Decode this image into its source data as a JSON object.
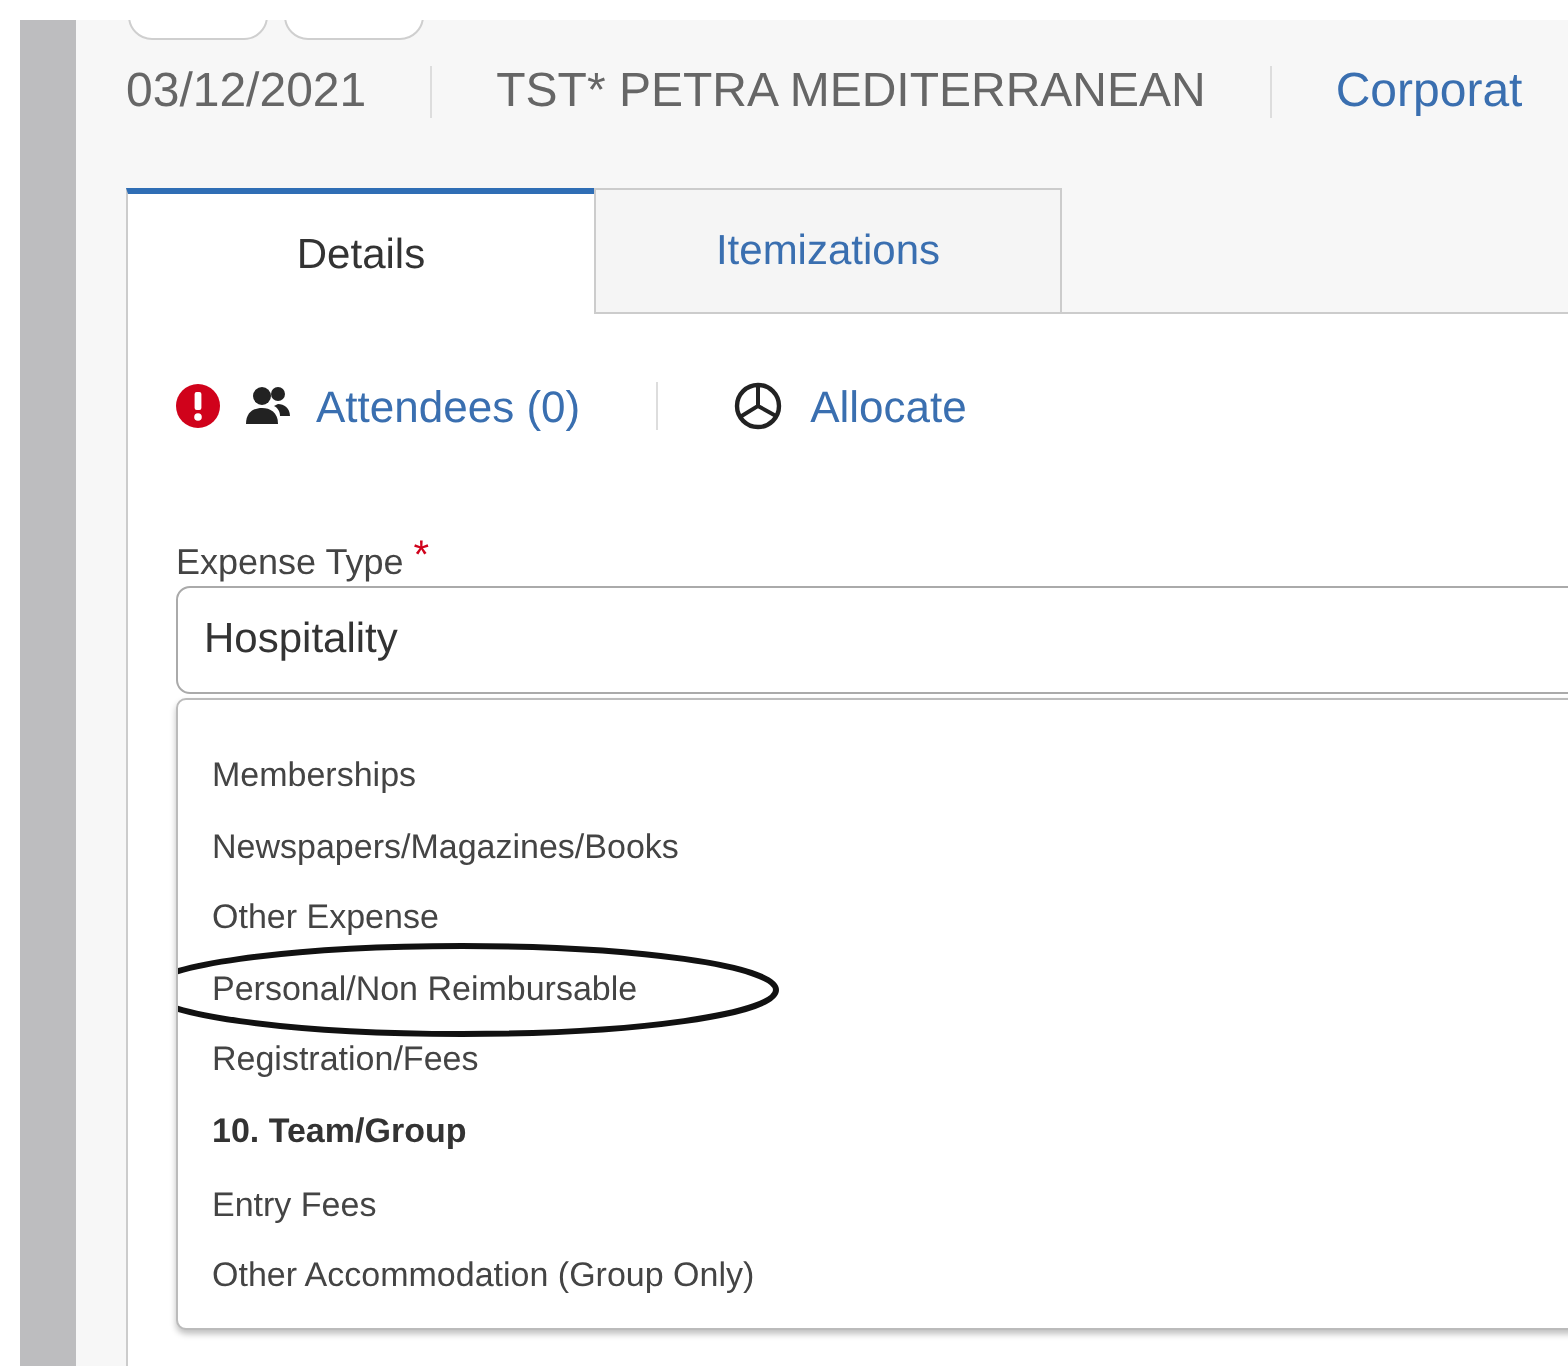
{
  "header": {
    "date": "03/12/2021",
    "merchant": "TST* PETRA MEDITERRANEAN",
    "link": "Corporat"
  },
  "tabs": [
    {
      "label": "Details",
      "selected": true
    },
    {
      "label": "Itemizations",
      "selected": false
    }
  ],
  "actions": {
    "attendees": "Attendees (0)",
    "attendees_warning": true,
    "allocate": "Allocate"
  },
  "expense_type": {
    "label": "Expense Type",
    "required": true,
    "required_mark": "*",
    "value": "Hospitality",
    "options": [
      {
        "kind": "option",
        "label": "Memberships",
        "circled": false
      },
      {
        "kind": "option",
        "label": "Newspapers/Magazines/Books",
        "circled": false
      },
      {
        "kind": "option",
        "label": "Other Expense",
        "circled": false
      },
      {
        "kind": "option",
        "label": "Personal/Non Reimbursable",
        "circled": true
      },
      {
        "kind": "option",
        "label": "Registration/Fees",
        "circled": false
      },
      {
        "kind": "header",
        "label": "10. Team/Group"
      },
      {
        "kind": "option",
        "label": "Entry Fees",
        "circled": false
      },
      {
        "kind": "option",
        "label": "Other Accommodation (Group Only)",
        "circled": false
      }
    ]
  }
}
